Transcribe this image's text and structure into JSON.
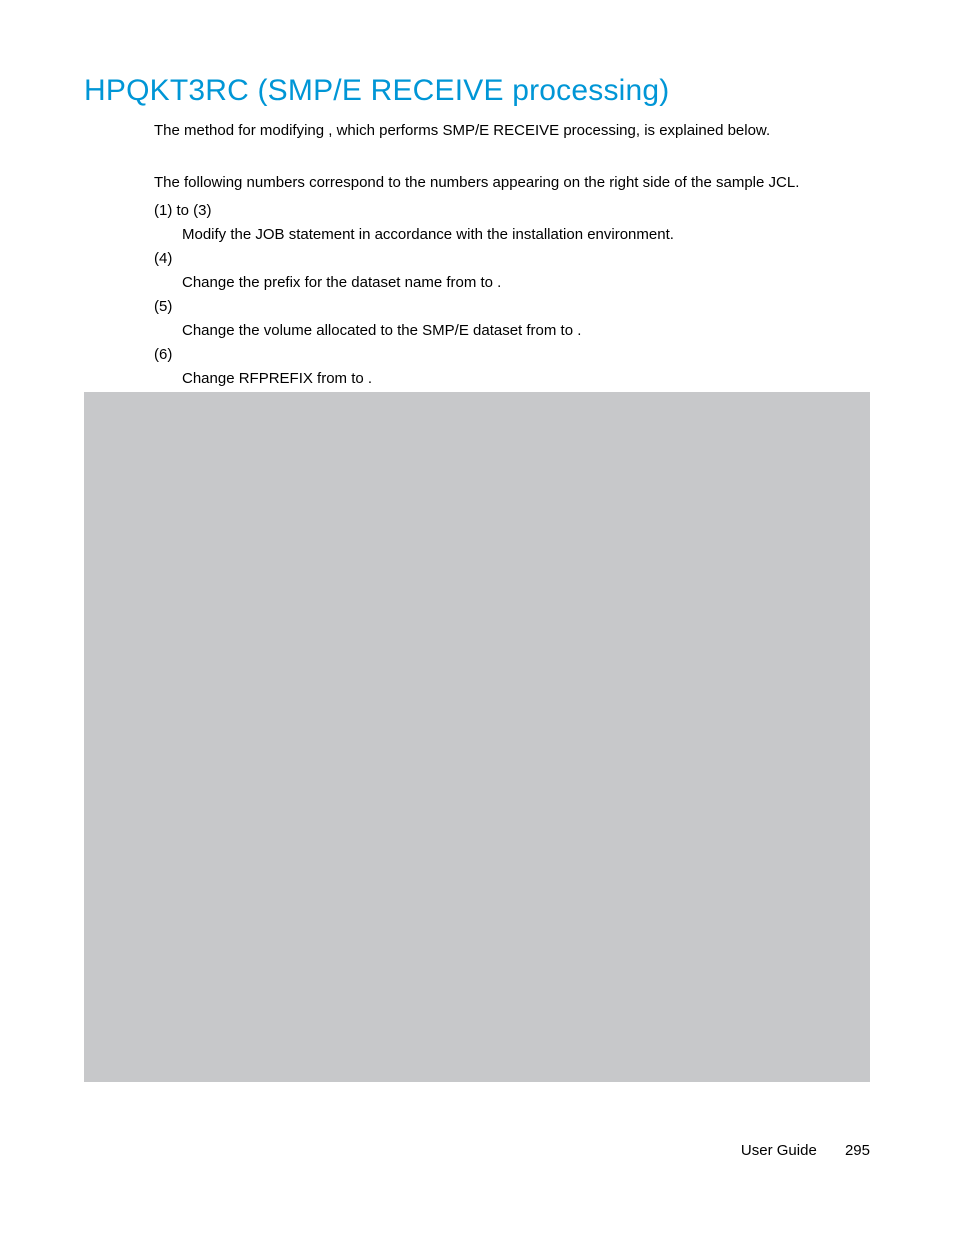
{
  "heading": "HPQKT3RC (SMP/E RECEIVE processing)",
  "intro": "The method for modifying                    , which performs SMP/E RECEIVE processing, is explained below.",
  "note": "The following numbers correspond to the numbers appearing on the right side of the sample JCL.",
  "items": [
    {
      "num": "(1) to (3)",
      "text": "Modify the JOB statement in accordance with the installation environment."
    },
    {
      "num": "(4)",
      "text": "Change the prefix for the dataset name from              to                ."
    },
    {
      "num": "(5)",
      "text": "Change the volume allocated to the SMP/E dataset from              to               ."
    },
    {
      "num": "(6)",
      "text": "Change RFPREFIX from       to               ."
    }
  ],
  "footer": {
    "label": "User Guide",
    "page": "295"
  }
}
